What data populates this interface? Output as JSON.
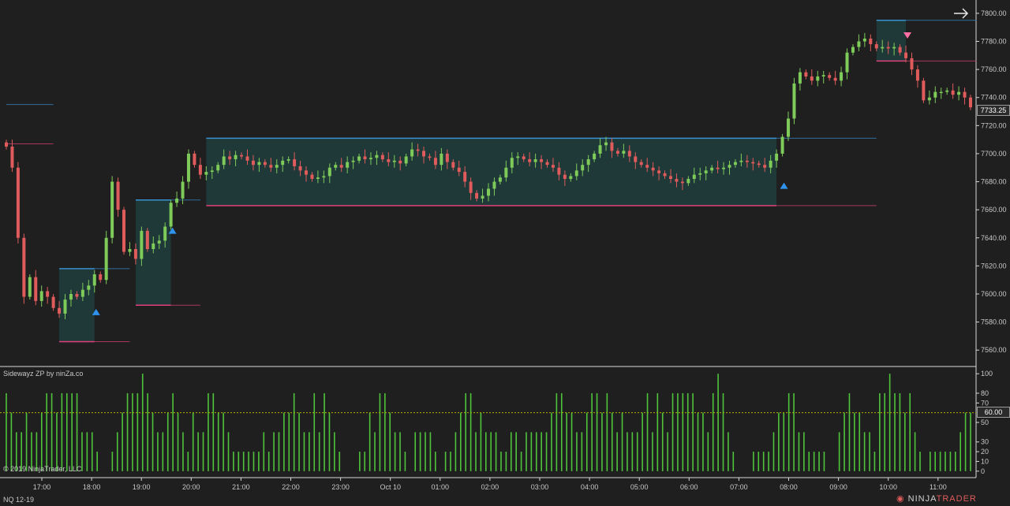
{
  "instrument": "NQ 12-19",
  "copyright": "© 2019 NinjaTrader, LLC",
  "indicator_label": "Sidewayz ZP by ninZa.co",
  "brand": {
    "ninja": "NINJA",
    "trader": "TRADER"
  },
  "last_price_label": "7733.25",
  "osc_level_label": "60.00",
  "colors": {
    "background": "#1f1f1f",
    "up_candle": "#7ecb5a",
    "down_candle": "#e05b5b",
    "zone_fill": "#1f3b3b",
    "zone_top": "#3a8fd0",
    "zone_bottom": "#e0407a",
    "osc_bar": "#4fc43a",
    "osc_level": "#b0b000",
    "buy_arrow": "#2f93ee",
    "sell_arrow": "#ff6fa6"
  },
  "chart_data": [
    {
      "type": "candlestick",
      "ylim": [
        7550,
        7805
      ],
      "y_ticks": [
        7560,
        7580,
        7600,
        7620,
        7640,
        7660,
        7680,
        7700,
        7720,
        7740,
        7760,
        7780,
        7800
      ],
      "y_tick_labels": [
        "7560.00",
        "7580.00",
        "7600.00",
        "7620.00",
        "7640.00",
        "7660.00",
        "7680.00",
        "7700.00",
        "7720.00",
        "7740.00",
        "7760.00",
        "7780.00",
        "7800.00"
      ],
      "x_tick_labels": [
        "17:00",
        "18:00",
        "19:00",
        "20:00",
        "21:00",
        "22:00",
        "23:00",
        "Oct 10",
        "01:00",
        "02:00",
        "03:00",
        "04:00",
        "05:00",
        "06:00",
        "07:00",
        "08:00",
        "09:00",
        "10:00",
        "11:00"
      ],
      "close_path": [
        [
          0,
          7705
        ],
        [
          1,
          7690
        ],
        [
          2,
          7640
        ],
        [
          3,
          7598
        ],
        [
          4,
          7612
        ],
        [
          5,
          7595
        ],
        [
          6,
          7602
        ],
        [
          7,
          7598
        ],
        [
          8,
          7590
        ],
        [
          9,
          7586
        ],
        [
          10,
          7596
        ],
        [
          11,
          7600
        ],
        [
          12,
          7598
        ],
        [
          13,
          7603
        ],
        [
          14,
          7606
        ],
        [
          15,
          7614
        ],
        [
          16,
          7610
        ],
        [
          17,
          7640
        ],
        [
          18,
          7680
        ],
        [
          19,
          7660
        ],
        [
          20,
          7630
        ],
        [
          21,
          7632
        ],
        [
          22,
          7625
        ],
        [
          23,
          7645
        ],
        [
          24,
          7632
        ],
        [
          25,
          7636
        ],
        [
          26,
          7638
        ],
        [
          27,
          7648
        ],
        [
          28,
          7665
        ],
        [
          29,
          7668
        ],
        [
          30,
          7680
        ],
        [
          31,
          7700
        ],
        [
          32,
          7692
        ],
        [
          33,
          7685
        ],
        [
          34,
          7687
        ],
        [
          35,
          7688
        ],
        [
          36,
          7692
        ],
        [
          37,
          7698
        ],
        [
          38,
          7696
        ],
        [
          39,
          7699
        ],
        [
          40,
          7698
        ],
        [
          41,
          7695
        ],
        [
          42,
          7692
        ],
        [
          43,
          7694
        ],
        [
          44,
          7692
        ],
        [
          45,
          7690
        ],
        [
          46,
          7692
        ],
        [
          47,
          7695
        ],
        [
          48,
          7696
        ],
        [
          49,
          7691
        ],
        [
          50,
          7688
        ],
        [
          51,
          7685
        ],
        [
          52,
          7682
        ],
        [
          53,
          7683
        ],
        [
          54,
          7684
        ],
        [
          55,
          7690
        ],
        [
          56,
          7692
        ],
        [
          57,
          7690
        ],
        [
          58,
          7694
        ],
        [
          59,
          7695
        ],
        [
          60,
          7698
        ],
        [
          61,
          7696
        ],
        [
          62,
          7697
        ],
        [
          63,
          7699
        ],
        [
          64,
          7696
        ],
        [
          65,
          7694
        ],
        [
          66,
          7695
        ],
        [
          67,
          7693
        ],
        [
          68,
          7698
        ],
        [
          69,
          7703
        ],
        [
          70,
          7702
        ],
        [
          71,
          7698
        ],
        [
          72,
          7697
        ],
        [
          73,
          7692
        ],
        [
          74,
          7700
        ],
        [
          75,
          7694
        ],
        [
          76,
          7690
        ],
        [
          77,
          7687
        ],
        [
          78,
          7680
        ],
        [
          79,
          7672
        ],
        [
          80,
          7668
        ],
        [
          81,
          7670
        ],
        [
          82,
          7675
        ],
        [
          83,
          7680
        ],
        [
          84,
          7683
        ],
        [
          85,
          7690
        ],
        [
          86,
          7697
        ],
        [
          87,
          7698
        ],
        [
          88,
          7696
        ],
        [
          89,
          7694
        ],
        [
          90,
          7696
        ],
        [
          91,
          7694
        ],
        [
          92,
          7692
        ],
        [
          93,
          7690
        ],
        [
          94,
          7685
        ],
        [
          95,
          7682
        ],
        [
          96,
          7684
        ],
        [
          97,
          7688
        ],
        [
          98,
          7692
        ],
        [
          99,
          7696
        ],
        [
          100,
          7700
        ],
        [
          101,
          7706
        ],
        [
          102,
          7708
        ],
        [
          103,
          7702
        ],
        [
          104,
          7700
        ],
        [
          105,
          7702
        ],
        [
          106,
          7698
        ],
        [
          107,
          7694
        ],
        [
          108,
          7692
        ],
        [
          109,
          7690
        ],
        [
          110,
          7688
        ],
        [
          111,
          7686
        ],
        [
          112,
          7684
        ],
        [
          113,
          7682
        ],
        [
          114,
          7680
        ],
        [
          115,
          7679
        ],
        [
          116,
          7682
        ],
        [
          117,
          7685
        ],
        [
          118,
          7686
        ],
        [
          119,
          7688
        ],
        [
          120,
          7690
        ],
        [
          121,
          7689
        ],
        [
          122,
          7690
        ],
        [
          123,
          7692
        ],
        [
          124,
          7694
        ],
        [
          125,
          7695
        ],
        [
          126,
          7694
        ],
        [
          127,
          7693
        ],
        [
          128,
          7692
        ],
        [
          129,
          7690
        ],
        [
          130,
          7695
        ],
        [
          131,
          7700
        ],
        [
          132,
          7712
        ],
        [
          133,
          7725
        ],
        [
          134,
          7750
        ],
        [
          135,
          7758
        ],
        [
          136,
          7755
        ],
        [
          137,
          7752
        ],
        [
          138,
          7755
        ],
        [
          139,
          7756
        ],
        [
          140,
          7754
        ],
        [
          141,
          7752
        ],
        [
          142,
          7758
        ],
        [
          143,
          7772
        ],
        [
          144,
          7776
        ],
        [
          145,
          7780
        ],
        [
          146,
          7782
        ],
        [
          147,
          7778
        ],
        [
          148,
          7775
        ],
        [
          149,
          7776
        ],
        [
          150,
          7775
        ],
        [
          151,
          7776
        ],
        [
          152,
          7772
        ],
        [
          153,
          7768
        ],
        [
          154,
          7760
        ],
        [
          155,
          7752
        ],
        [
          156,
          7738
        ],
        [
          157,
          7740
        ],
        [
          158,
          7744
        ],
        [
          159,
          7744
        ],
        [
          160,
          7745
        ],
        [
          161,
          7742
        ],
        [
          162,
          7744
        ],
        [
          163,
          7740
        ],
        [
          164,
          7733
        ]
      ],
      "zones": [
        {
          "from": 9,
          "to": 15,
          "top": 7618,
          "bottom": 7566
        },
        {
          "from": 22,
          "to": 28,
          "top": 7667,
          "bottom": 7592
        },
        {
          "from": 34,
          "to": 131,
          "top": 7711,
          "bottom": 7663
        },
        {
          "from": 148,
          "to": 153,
          "top": 7795,
          "bottom": 7766
        }
      ],
      "level_lines": [
        {
          "value": 7735,
          "from": 0,
          "to": 8,
          "color": "zone_top"
        },
        {
          "value": 7707,
          "from": 0,
          "to": 8,
          "color": "zone_bottom"
        },
        {
          "value": 7566,
          "from": 15,
          "to": 21,
          "color": "zone_bottom"
        },
        {
          "value": 7618,
          "from": 15,
          "to": 21,
          "color": "zone_top"
        },
        {
          "value": 7667,
          "from": 28,
          "to": 33,
          "color": "zone_top"
        },
        {
          "value": 7592,
          "from": 28,
          "to": 33,
          "color": "zone_bottom"
        },
        {
          "value": 7711,
          "from": 131,
          "to": 148,
          "color": "zone_top"
        },
        {
          "value": 7663,
          "from": 131,
          "to": 148,
          "color": "zone_bottom"
        },
        {
          "value": 7795,
          "from": 153,
          "to": 165,
          "color": "zone_top"
        },
        {
          "value": 7766,
          "from": 153,
          "to": 165,
          "color": "zone_bottom"
        }
      ],
      "signals": [
        {
          "bar": 15,
          "type": "buy",
          "value": 7595
        },
        {
          "bar": 28,
          "type": "buy",
          "value": 7653
        },
        {
          "bar": 132,
          "type": "buy",
          "value": 7685
        },
        {
          "bar": 153,
          "type": "sell",
          "value": 7782
        }
      ]
    },
    {
      "type": "bar",
      "title": "Sidewayz ZP by ninZa.co",
      "ylim": [
        -5,
        105
      ],
      "y_ticks": [
        0,
        10,
        20,
        30,
        50,
        70,
        80,
        100
      ],
      "level": 60,
      "values": [
        80,
        60,
        40,
        40,
        60,
        40,
        40,
        60,
        80,
        80,
        60,
        80,
        80,
        80,
        80,
        40,
        40,
        40,
        20,
        0,
        0,
        20,
        40,
        60,
        80,
        80,
        80,
        100,
        80,
        60,
        40,
        40,
        60,
        80,
        60,
        40,
        20,
        60,
        40,
        40,
        80,
        80,
        60,
        60,
        40,
        20,
        20,
        20,
        20,
        20,
        20,
        40,
        20,
        40,
        40,
        60,
        60,
        80,
        60,
        40,
        40,
        80,
        40,
        80,
        60,
        40,
        20,
        0,
        0,
        0,
        20,
        20,
        60,
        40,
        80,
        80,
        60,
        40,
        40,
        20,
        0,
        40,
        40,
        40,
        40,
        20,
        0,
        20,
        20,
        40,
        60,
        80,
        80,
        40,
        60,
        40,
        40,
        40,
        20,
        20,
        40,
        40,
        20,
        40,
        40,
        40,
        40,
        40,
        60,
        80,
        80,
        60,
        60,
        40,
        40,
        60,
        80,
        80,
        60,
        80,
        60,
        40,
        60,
        40,
        40,
        40,
        60,
        80,
        40,
        80,
        60,
        40,
        80,
        80,
        80,
        80,
        80,
        60,
        60,
        40,
        80,
        100,
        80,
        40,
        20,
        0,
        0,
        0,
        20,
        20,
        20,
        20,
        40,
        60,
        60,
        80,
        80,
        40,
        40,
        20,
        20,
        20,
        20,
        0,
        0,
        40,
        60,
        80,
        60,
        60,
        40,
        40,
        20,
        80,
        80,
        100,
        80,
        80,
        60,
        80,
        40,
        20,
        0,
        20,
        20,
        20,
        20,
        20,
        20,
        40,
        60,
        60
      ]
    }
  ]
}
